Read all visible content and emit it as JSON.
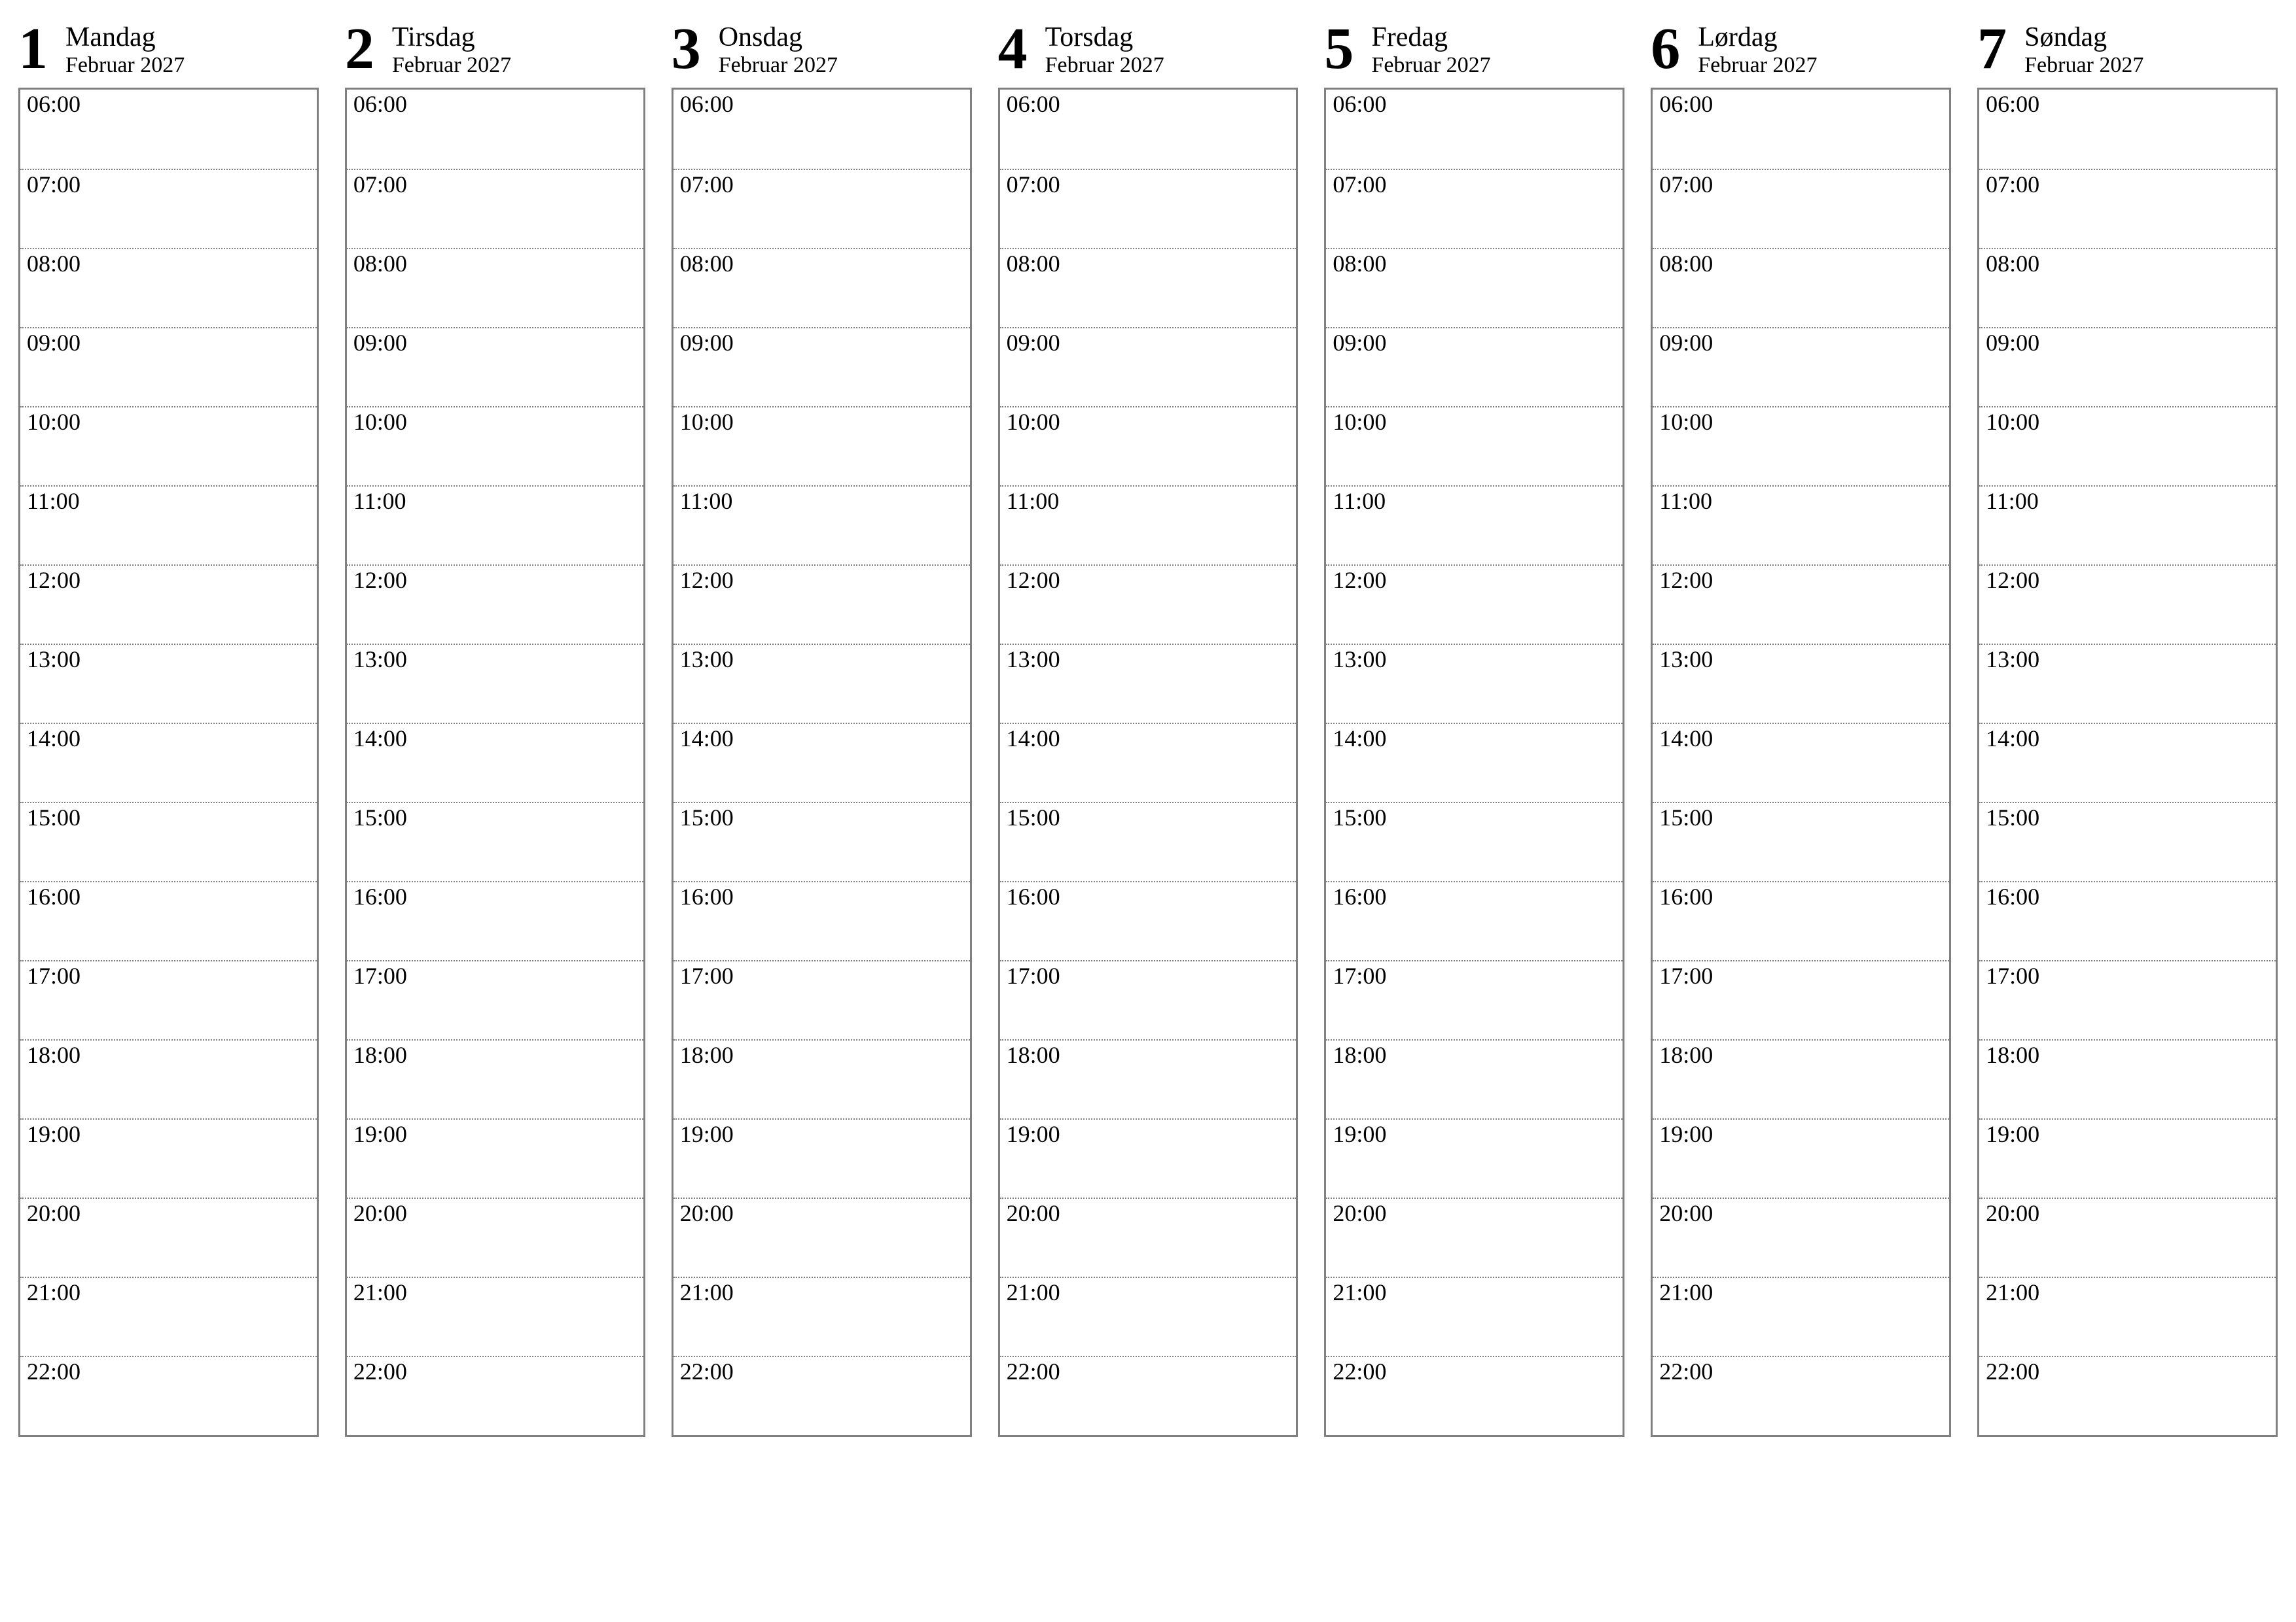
{
  "monthYear": "Februar 2027",
  "hours": [
    "06:00",
    "07:00",
    "08:00",
    "09:00",
    "10:00",
    "11:00",
    "12:00",
    "13:00",
    "14:00",
    "15:00",
    "16:00",
    "17:00",
    "18:00",
    "19:00",
    "20:00",
    "21:00",
    "22:00"
  ],
  "days": [
    {
      "num": "1",
      "name": "Mandag"
    },
    {
      "num": "2",
      "name": "Tirsdag"
    },
    {
      "num": "3",
      "name": "Onsdag"
    },
    {
      "num": "4",
      "name": "Torsdag"
    },
    {
      "num": "5",
      "name": "Fredag"
    },
    {
      "num": "6",
      "name": "Lørdag"
    },
    {
      "num": "7",
      "name": "Søndag"
    }
  ]
}
